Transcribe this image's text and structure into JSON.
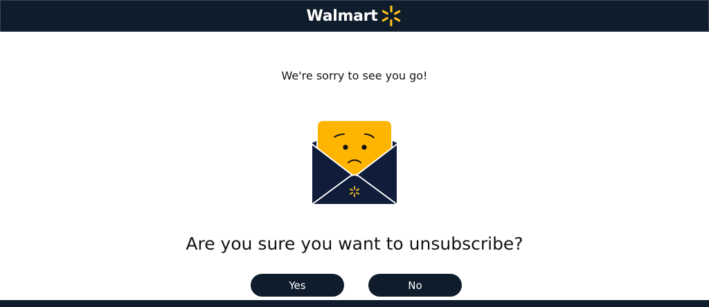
{
  "header": {
    "brand_name": "Walmart",
    "brand_icon": "spark-icon",
    "background_color": "#0f1c2b",
    "spark_color": "#ffc220"
  },
  "main": {
    "farewell_text": "We're sorry to see you go!",
    "illustration_icon": "sad-envelope-icon",
    "question": "Are you sure you want to unsubscribe?"
  },
  "actions": {
    "yes_label": "Yes",
    "no_label": "No"
  }
}
